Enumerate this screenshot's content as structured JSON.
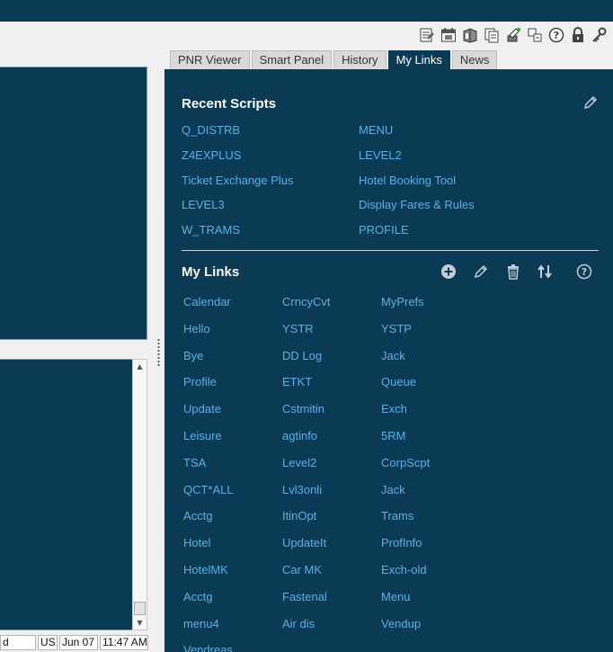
{
  "tabs": [
    "PNR Viewer",
    "Smart Panel",
    "History",
    "My Links",
    "News"
  ],
  "active_tab": "My Links",
  "recent_scripts": {
    "title": "Recent Scripts",
    "col1": [
      "Q_DISTRB",
      "Z4EXPLUS",
      "Ticket Exchange Plus",
      "LEVEL3",
      "W_TRAMS"
    ],
    "col2": [
      "MENU",
      "LEVEL2",
      "Hotel Booking Tool",
      "Display Fares & Rules",
      "PROFILE"
    ]
  },
  "my_links": {
    "title": "My Links",
    "col1": [
      "Calendar",
      "Hello",
      "Bye",
      "Profile",
      "Update",
      "Leisure",
      "TSA",
      "QCT*ALL",
      "Acctg",
      "Hotel",
      "HotelMK",
      "Acctg",
      "menu4",
      "Vendreas"
    ],
    "col2": [
      "CrncyCvt",
      "YSTR",
      "DD Log",
      "ETKT",
      "Cstmitin",
      "agtinfo",
      "Level2",
      "Lvl3onli",
      "ItinOpt",
      "UpdateIt",
      "Car MK",
      "Fastenal",
      "Air dis"
    ],
    "col3": [
      "MyPrefs",
      "YSTP",
      "Jack",
      "Queue",
      "Exch",
      "5RM",
      "CorpScpt",
      "Jack",
      "Trams",
      "ProfInfo",
      "Exch-old",
      "Menu",
      "Vendup"
    ]
  },
  "statusbar": {
    "field": "d",
    "locale": "US",
    "date": "Jun 07",
    "time": "11:47 AM"
  },
  "colors": {
    "panel_bg": "#0b3a55",
    "link": "#5bb1e6",
    "tab_bg": "#d9d9d9"
  },
  "icons": [
    "notes-icon",
    "calendar-icon",
    "books-icon",
    "copy-icon",
    "tools-icon",
    "grid-icon",
    "help-icon",
    "lock-icon",
    "key-icon"
  ]
}
